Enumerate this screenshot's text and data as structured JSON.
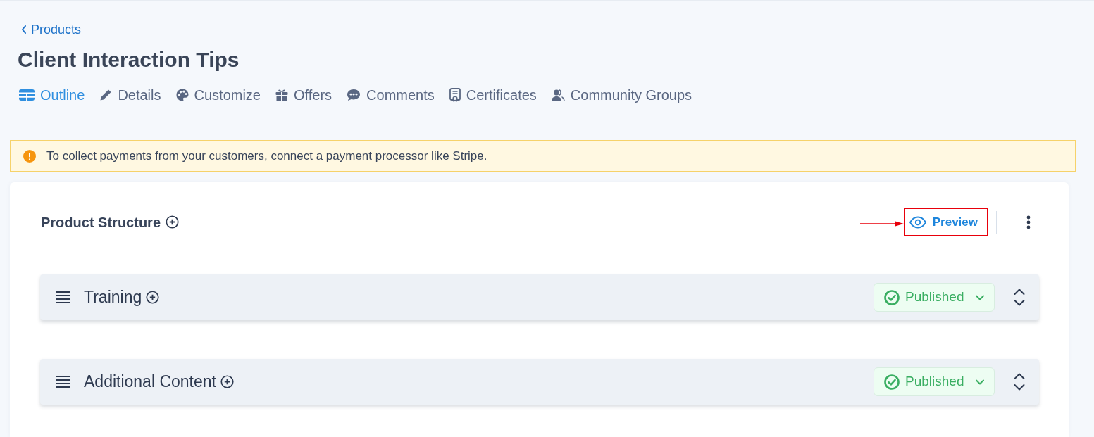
{
  "breadcrumb": {
    "label": "Products"
  },
  "title": "Client Interaction Tips",
  "tabs": [
    {
      "label": "Outline",
      "selected": true
    },
    {
      "label": "Details",
      "selected": false
    },
    {
      "label": "Customize",
      "selected": false
    },
    {
      "label": "Offers",
      "selected": false
    },
    {
      "label": "Comments",
      "selected": false
    },
    {
      "label": "Certificates",
      "selected": false
    },
    {
      "label": "Community Groups",
      "selected": false
    }
  ],
  "alert": {
    "text": "To collect payments from your customers, connect a payment processor like Stripe."
  },
  "structure": {
    "title": "Product Structure",
    "preview": {
      "label": "Preview",
      "highlighted": true
    },
    "sections": [
      {
        "title": "Training",
        "status": "Published"
      },
      {
        "title": "Additional Content",
        "status": "Published"
      }
    ]
  }
}
